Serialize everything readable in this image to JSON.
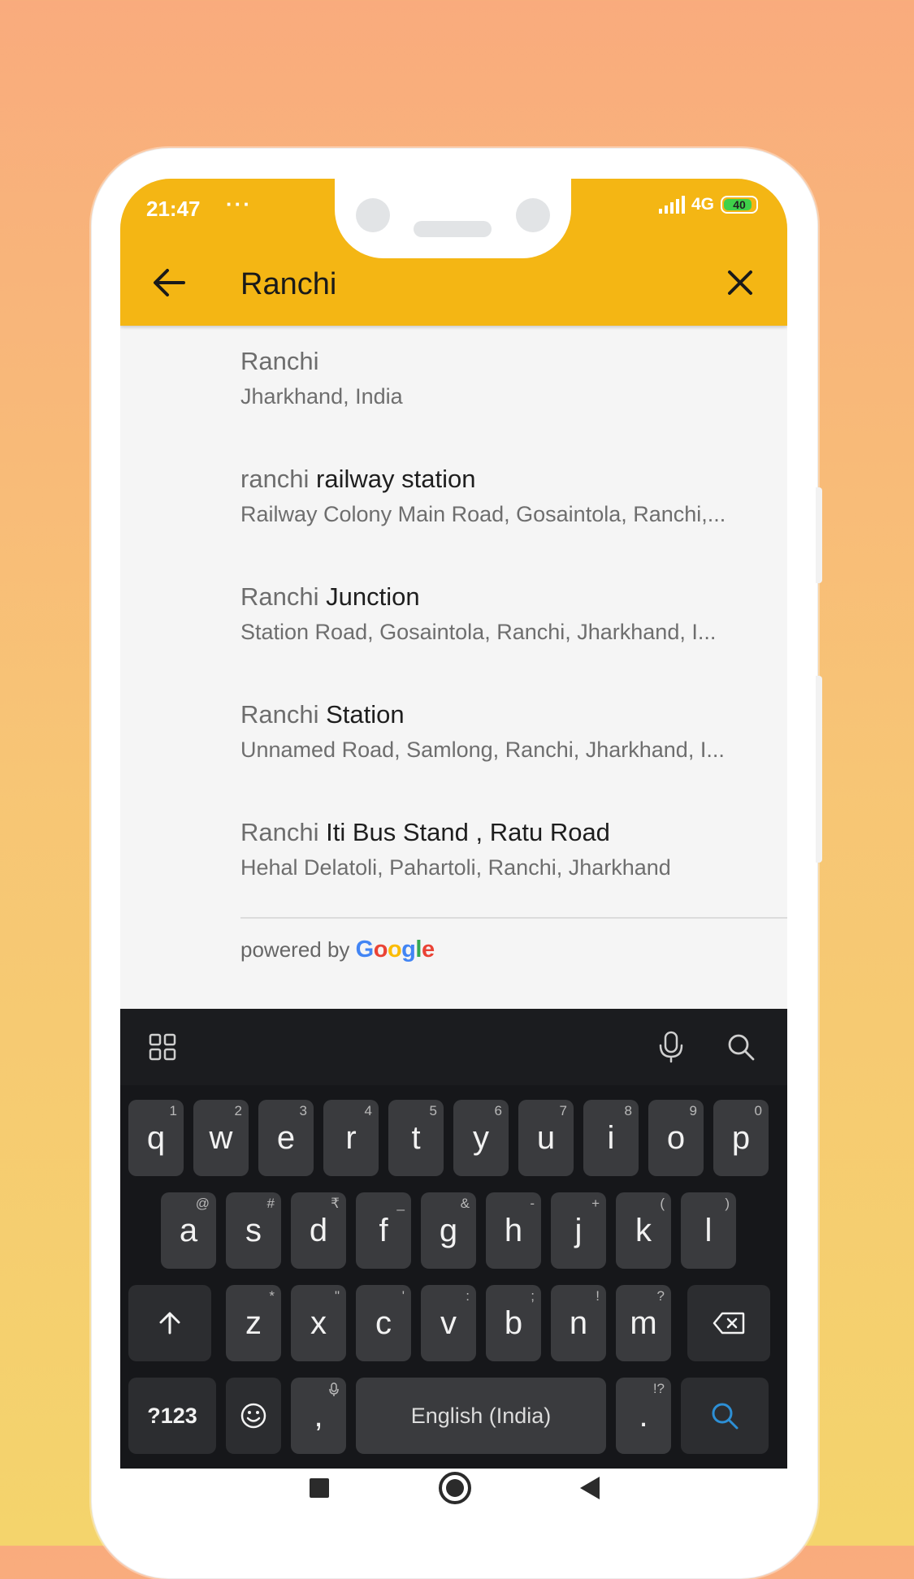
{
  "status_bar": {
    "time": "21:47",
    "dots": "···",
    "network": "4G",
    "battery_level": "40"
  },
  "search": {
    "query": "Ranchi"
  },
  "results": [
    {
      "highlight": "Ranchi",
      "rest": "",
      "subtitle": "Jharkhand, India"
    },
    {
      "highlight": "ranchi",
      "rest": " railway station",
      "subtitle": "Railway Colony Main Road, Gosaintola, Ranchi,..."
    },
    {
      "highlight": "Ranchi",
      "rest": " Junction",
      "subtitle": "Station Road, Gosaintola, Ranchi, Jharkhand, I..."
    },
    {
      "highlight": "Ranchi",
      "rest": " Station",
      "subtitle": "Unnamed Road, Samlong, Ranchi, Jharkhand, I..."
    },
    {
      "highlight": "Ranchi",
      "rest": " Iti Bus Stand , Ratu Road",
      "subtitle": "Hehal Delatoli, Pahartoli, Ranchi, Jharkhand"
    }
  ],
  "attribution": {
    "powered_by": "powered by",
    "google": [
      "G",
      "o",
      "o",
      "g",
      "l",
      "e"
    ]
  },
  "keyboard": {
    "row1": [
      [
        "q",
        "1"
      ],
      [
        "w",
        "2"
      ],
      [
        "e",
        "3"
      ],
      [
        "r",
        "4"
      ],
      [
        "t",
        "5"
      ],
      [
        "y",
        "6"
      ],
      [
        "u",
        "7"
      ],
      [
        "i",
        "8"
      ],
      [
        "o",
        "9"
      ],
      [
        "p",
        "0"
      ]
    ],
    "row2": [
      [
        "a",
        "@"
      ],
      [
        "s",
        "#"
      ],
      [
        "d",
        "₹"
      ],
      [
        "f",
        "_"
      ],
      [
        "g",
        "&"
      ],
      [
        "h",
        "-"
      ],
      [
        "j",
        "+"
      ],
      [
        "k",
        "("
      ],
      [
        "l",
        ")"
      ]
    ],
    "row3": [
      [
        "z",
        "*"
      ],
      [
        "x",
        "\""
      ],
      [
        "c",
        "'"
      ],
      [
        "v",
        ":"
      ],
      [
        "b",
        ";"
      ],
      [
        "n",
        "!"
      ],
      [
        "m",
        "?"
      ]
    ],
    "symbols_label": "?123",
    "comma": ",",
    "space_label": "English (India)",
    "period": ".",
    "period_hint": "!?"
  },
  "colors": {
    "appbar": "#f4b614",
    "keyboard_bg": "#16171a",
    "key_bg": "#3a3b3e",
    "search_key": "#2d8fd5"
  }
}
